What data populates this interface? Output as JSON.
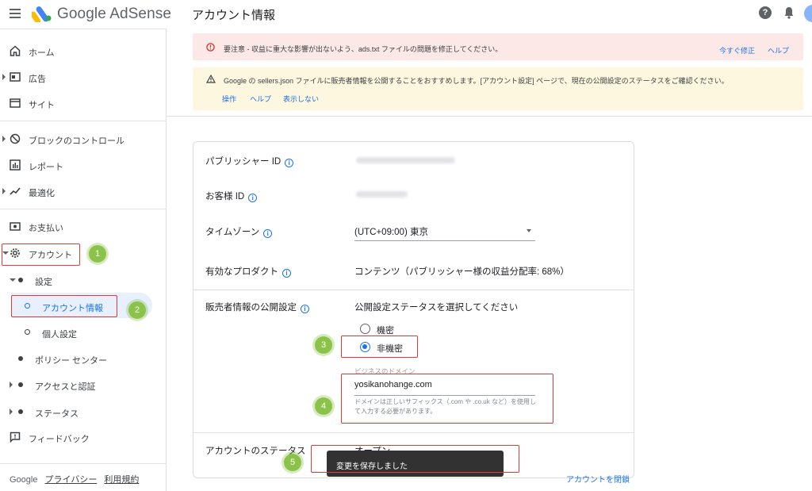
{
  "header": {
    "brand_google": "Google",
    "brand_product": "AdSense",
    "page_title": "アカウント情報",
    "help_glyph": "?"
  },
  "sidebar": {
    "items": [
      {
        "label": "ホーム",
        "icon": "home-icon"
      },
      {
        "label": "広告",
        "icon": "ads-icon"
      },
      {
        "label": "サイト",
        "icon": "sites-icon"
      },
      {
        "label": "ブロックのコントロール",
        "icon": "block-icon"
      },
      {
        "label": "レポート",
        "icon": "report-icon"
      },
      {
        "label": "最適化",
        "icon": "optimization-icon"
      },
      {
        "label": "お支払い",
        "icon": "payments-icon"
      },
      {
        "label": "アカウント",
        "icon": "gear-icon"
      },
      {
        "label": "設定"
      },
      {
        "label": "アカウント情報"
      },
      {
        "label": "個人設定"
      },
      {
        "label": "ポリシー センター"
      },
      {
        "label": "アクセスと認証"
      },
      {
        "label": "ステータス"
      },
      {
        "label": "フィードバック",
        "icon": "feedback-icon"
      }
    ],
    "footer": {
      "google": "Google",
      "privacy": "プライバシー",
      "terms": "利用規約"
    }
  },
  "alerts": {
    "error": {
      "text": "要注意 - 収益に重大な影響が出ないよう、ads.txt ファイルの問題を修正してください。",
      "fix_now": "今すぐ修正",
      "help": "ヘルプ"
    },
    "warning": {
      "text": "Google の sellers.json ファイルに販売者情報を公開することをおすすめします。[アカウント設定] ページで、現在の公開設定のステータスをご確認ください。",
      "action": "操作",
      "help": "ヘルプ",
      "hide": "表示しない"
    }
  },
  "account": {
    "publisher_id_label": "パブリッシャー ID",
    "customer_id_label": "お客様 ID",
    "timezone_label": "タイムゾーン",
    "timezone_value": "(UTC+09:00) 東京",
    "products_label": "有効なプロダクト",
    "products_value": "コンテンツ（パブリッシャー様の収益分配率: 68%）",
    "seller_info_label": "販売者情報の公開設定",
    "seller_info_prompt": "公開設定ステータスを選択してください",
    "option_confidential": "機密",
    "option_non_confidential": "非機密",
    "selected_option": "非機密",
    "business_domain_label": "ビジネスのドメイン",
    "business_domain_value": "yosikanohange.com",
    "domain_help": "ドメインは正しいサフィックス（.com や .co.uk など）を使用して入力する必要があります。",
    "status_label": "アカウントのステータス",
    "status_value": "オープン",
    "close_account": "アカウントを閉鎖",
    "info_glyph": "i"
  },
  "snackbar": {
    "text": "変更を保存しました"
  },
  "annotations": [
    "1",
    "2",
    "3",
    "4",
    "5"
  ],
  "colors": {
    "accent": "#1a73e8",
    "annotation_box": "#e53935",
    "annotation_badge": "#8bc34a",
    "error_bg": "#fce8e6",
    "warning_bg": "#fef7e0"
  }
}
